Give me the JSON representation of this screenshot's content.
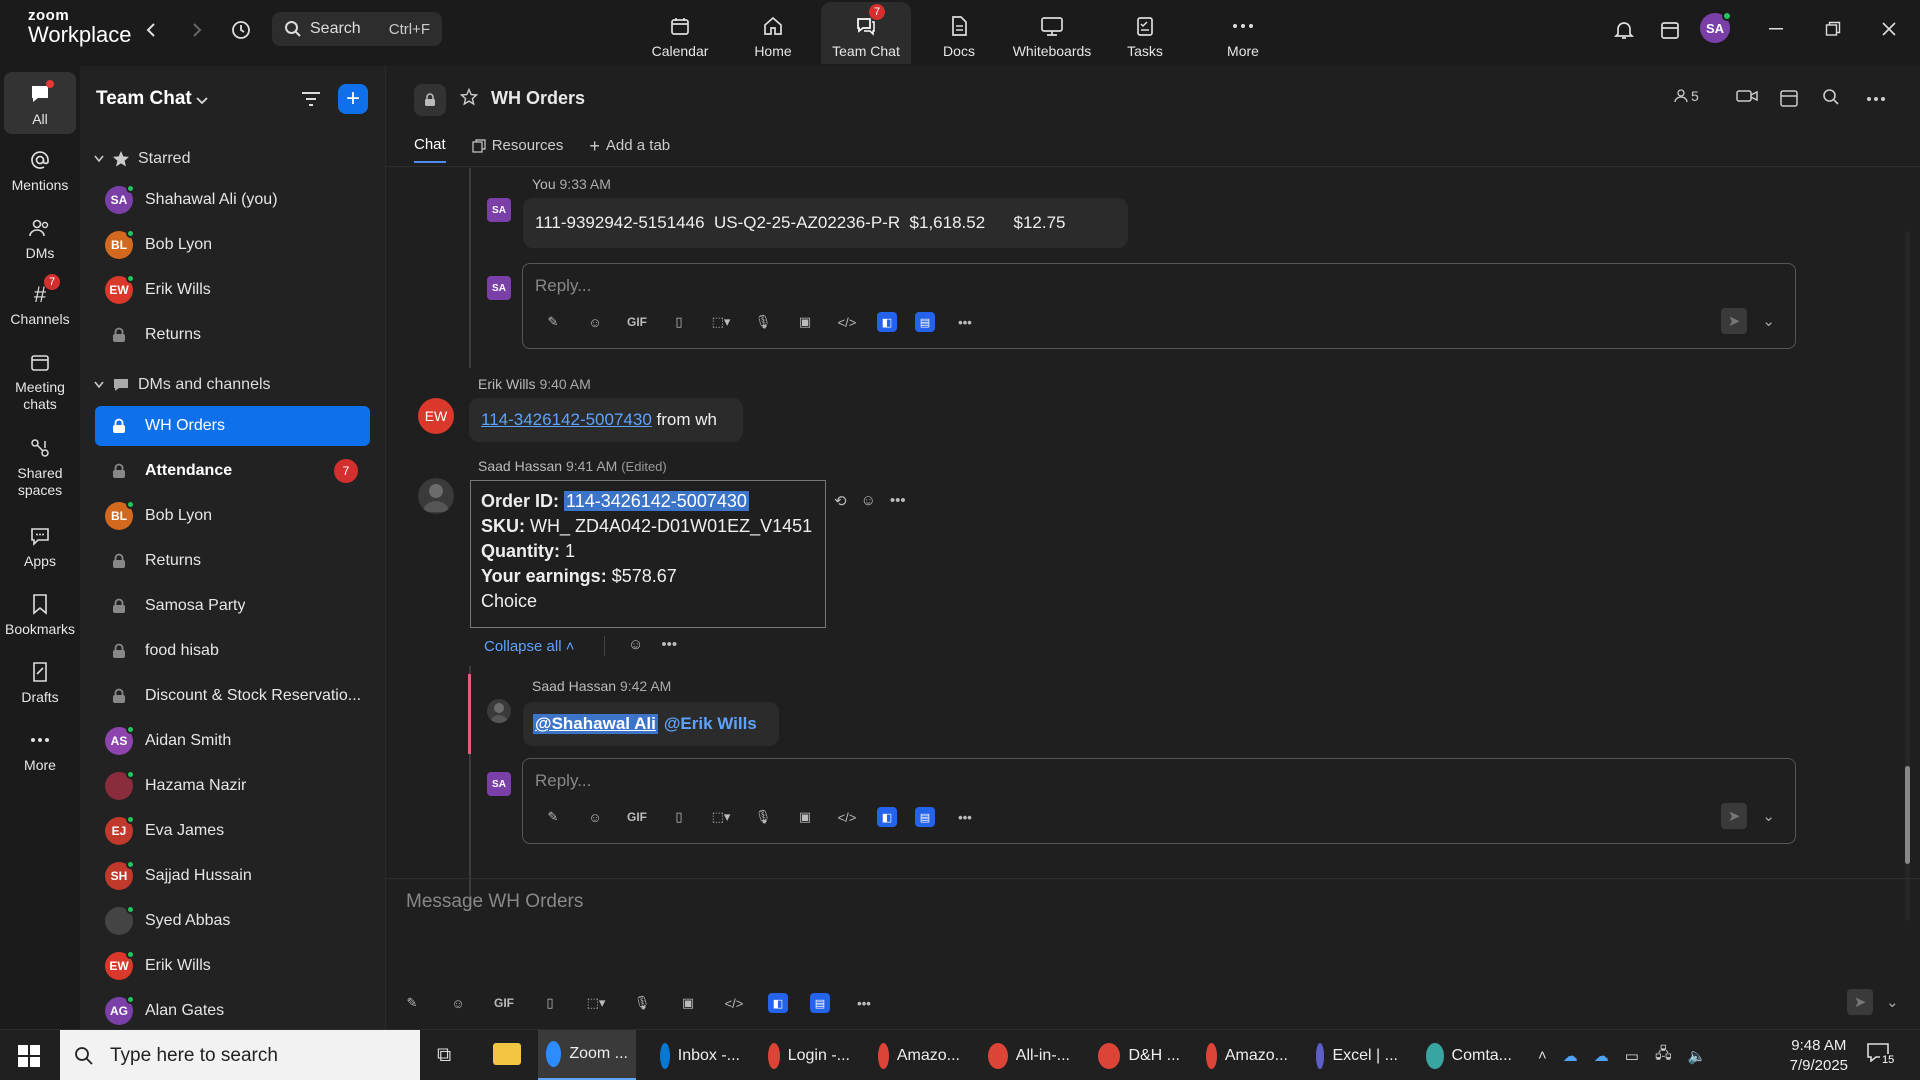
{
  "app": {
    "logo_line1": "zoom",
    "logo_line2": "Workplace"
  },
  "topbar": {
    "search_label": "Search",
    "search_shortcut": "Ctrl+F",
    "nav": [
      {
        "label": "Calendar",
        "icon": "calendar-icon"
      },
      {
        "label": "Home",
        "icon": "home-icon"
      },
      {
        "label": "Team Chat",
        "icon": "chat-icon",
        "badge": "7",
        "active": true
      },
      {
        "label": "Docs",
        "icon": "docs-icon"
      },
      {
        "label": "Whiteboards",
        "icon": "whiteboard-icon"
      },
      {
        "label": "Tasks",
        "icon": "tasks-icon"
      },
      {
        "label": "More",
        "icon": "more-icon"
      }
    ],
    "user_initials": "SA"
  },
  "rail": [
    {
      "label": "All",
      "icon": "chat-icon"
    },
    {
      "label": "Mentions",
      "icon": "at-icon"
    },
    {
      "label": "DMs",
      "icon": "people-icon"
    },
    {
      "label": "Channels",
      "icon": "hash-icon",
      "badge": "7"
    },
    {
      "label": "Meeting chats",
      "icon": "calendar-icon"
    },
    {
      "label": "Shared spaces",
      "icon": "shared-icon"
    },
    {
      "label": "Apps",
      "icon": "apps-icon"
    },
    {
      "label": "Bookmarks",
      "icon": "bookmark-icon"
    },
    {
      "label": "Drafts",
      "icon": "drafts-icon"
    },
    {
      "label": "More",
      "icon": "more-icon"
    }
  ],
  "sidebar": {
    "title": "Team Chat",
    "starred_label": "Starred",
    "starred": [
      {
        "type": "user",
        "initials": "SA",
        "name": "Shahawal Ali (you)",
        "color": "#7b3fa8"
      },
      {
        "type": "user",
        "initials": "BL",
        "name": "Bob Lyon",
        "color": "#d2691e"
      },
      {
        "type": "user",
        "initials": "EW",
        "name": "Erik Wills",
        "color": "#d9382b"
      },
      {
        "type": "channel",
        "name": "Returns"
      }
    ],
    "dms_label": "DMs and channels",
    "dms": [
      {
        "type": "channel",
        "name": "WH Orders",
        "active": true
      },
      {
        "type": "channel",
        "name": "Attendance",
        "bold": true,
        "count": "7"
      },
      {
        "type": "user",
        "initials": "BL",
        "name": "Bob Lyon",
        "color": "#d2691e"
      },
      {
        "type": "channel",
        "name": "Returns"
      },
      {
        "type": "channel",
        "name": "Samosa Party"
      },
      {
        "type": "channel",
        "name": "food hisab"
      },
      {
        "type": "channel",
        "name": "Discount & Stock Reservatio..."
      },
      {
        "type": "user",
        "initials": "AS",
        "name": "Aidan Smith",
        "color": "#8e44ad"
      },
      {
        "type": "user",
        "initials": "",
        "name": "Hazama Nazir",
        "color": "#8a2c3c"
      },
      {
        "type": "user",
        "initials": "EJ",
        "name": "Eva James",
        "color": "#c0392b"
      },
      {
        "type": "user",
        "initials": "SH",
        "name": "Sajjad Hussain",
        "color": "#c0392b"
      },
      {
        "type": "user",
        "initials": "",
        "name": "Syed Abbas",
        "color": "#444"
      },
      {
        "type": "user",
        "initials": "EW",
        "name": "Erik Wills",
        "color": "#d9382b"
      },
      {
        "type": "user",
        "initials": "AG",
        "name": "Alan Gates",
        "color": "#7b3fa8"
      }
    ]
  },
  "channel": {
    "name": "WH Orders",
    "member_count": "5",
    "tabs": [
      {
        "label": "Chat",
        "active": true
      },
      {
        "label": "Resources"
      },
      {
        "label": "Add a tab"
      }
    ]
  },
  "messages": {
    "m1_author": "You",
    "m1_time": "9:33 AM",
    "m1_text": "111-9392942-5151446  US-Q2-25-AZ02236-P-R  $1,618.52      $12.75",
    "reply_placeholder": "Reply...",
    "m2_author": "Erik Wills",
    "m2_time": "9:40 AM",
    "m2_initials": "EW",
    "m2_link": "114-3426142-5007430",
    "m2_rest": " from wh",
    "m3_author": "Saad Hassan",
    "m3_time": "9:41 AM",
    "m3_edited": "(Edited)",
    "order": {
      "id_label": "Order ID:",
      "id_value": "114-3426142-5007430",
      "sku_label": "SKU:",
      "sku_value": "WH_ ZD4A042-D01W01EZ_V1451",
      "qty_label": "Quantity:",
      "qty_value": "1",
      "earn_label": "Your earnings:",
      "earn_value": "$578.67",
      "extra": "Choice"
    },
    "collapse_label": "Collapse all",
    "m4_author": "Saad Hassan",
    "m4_time": "9:42 AM",
    "m4_mention1": "@Shahawal Ali",
    "m4_mention2": "@Erik Wills"
  },
  "composer": {
    "placeholder": "Message WH Orders"
  },
  "toolbar_gif": "GIF",
  "taskbar": {
    "search_placeholder": "Type here to search",
    "apps": [
      {
        "label": "Zoom ...",
        "color": "#2d8cff",
        "active": true
      },
      {
        "label": "Inbox -...",
        "color": "#0078d4"
      },
      {
        "label": "Login -...",
        "color": "#db4437"
      },
      {
        "label": "Amazo...",
        "color": "#db4437"
      },
      {
        "label": "All-in-...",
        "color": "#db4437"
      },
      {
        "label": "D&H ...",
        "color": "#db4437"
      },
      {
        "label": "Amazo...",
        "color": "#db4437"
      },
      {
        "label": "Excel | ...",
        "color": "#5b5fc7"
      },
      {
        "label": "Comta...",
        "color": "#3aa5a0"
      }
    ],
    "time": "9:48 AM",
    "date": "7/9/2025",
    "notif_count": "15"
  }
}
